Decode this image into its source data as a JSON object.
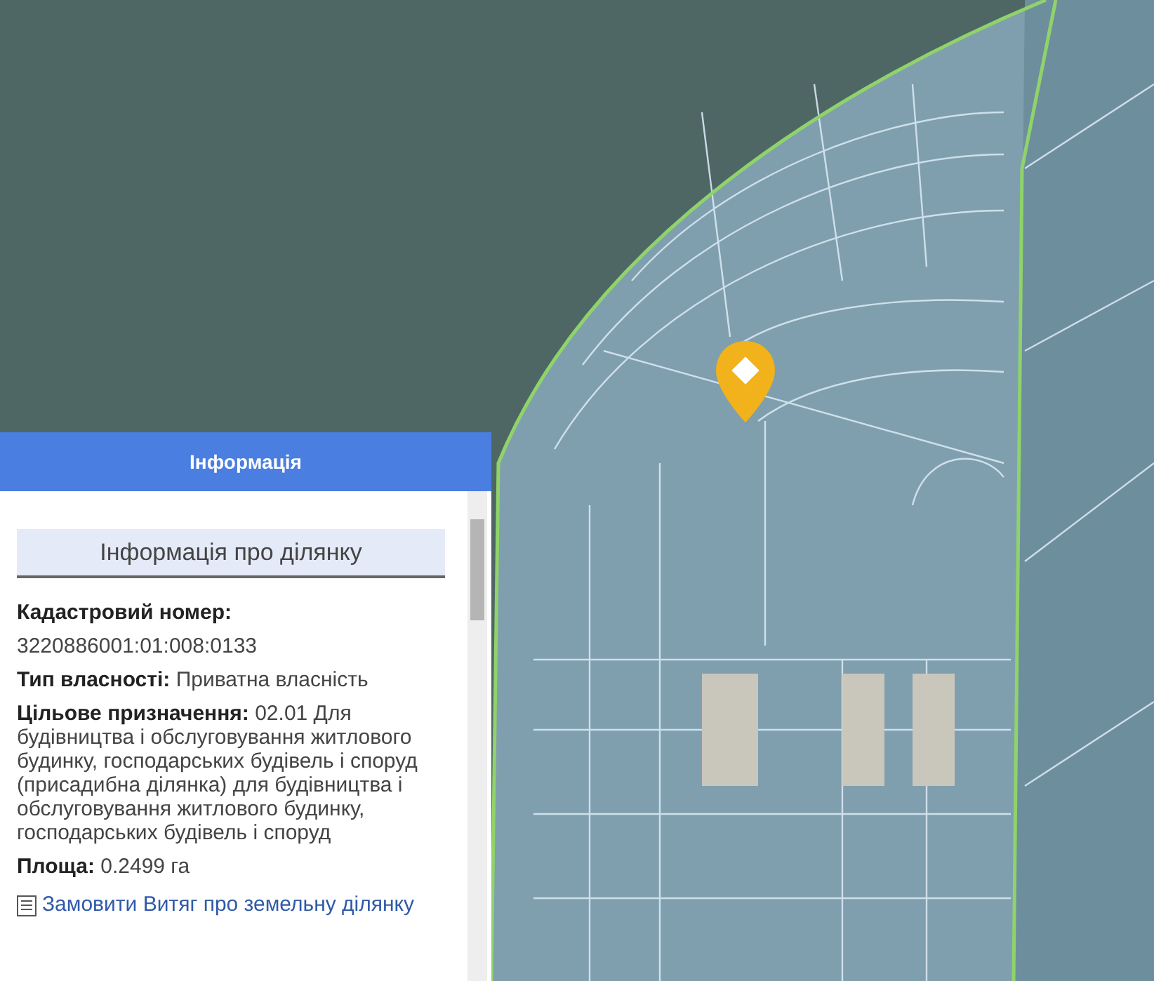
{
  "map": {
    "marker": true
  },
  "panel": {
    "title": "Інформація",
    "heading": "Інформація про ділянку",
    "fields": [
      {
        "text": "**Кадастровий номер:**"
      },
      {
        "text": "3220886001:01:008:0133"
      },
      {
        "text": "**Тип власності:** Приватна власність"
      },
      {
        "text": "**Цільове призначення:** 02.01 Для будівництва і обслуговування житлового будинку, господарських будівель і споруд (присадибна ділянка) для будівництва і обслуговування житлового будинку, господарських будівель і споруд"
      },
      {
        "text": "**Площа:** 0.2499 га"
      }
    ],
    "link": "Замовити Витяг про земельну ділянку"
  }
}
